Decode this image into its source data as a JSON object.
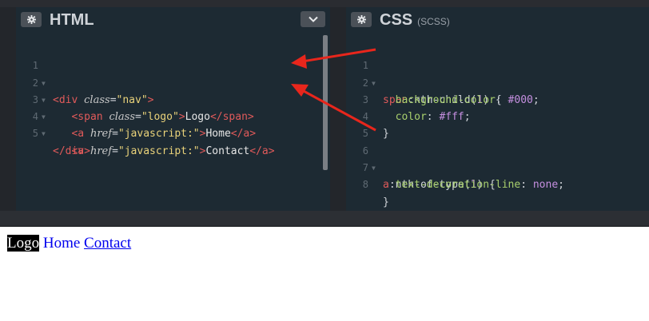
{
  "html_panel": {
    "title": "HTML",
    "lines": [
      {
        "n": "1",
        "fold": true
      },
      {
        "n": "2",
        "fold": true
      },
      {
        "n": "3",
        "fold": true
      },
      {
        "n": "4",
        "fold": true
      },
      {
        "n": "5",
        "fold": false
      }
    ],
    "code": {
      "l1": {
        "tag_open": "<div",
        "attr": "class",
        "eq": "=",
        "val": "\"nav\"",
        "close": ">"
      },
      "l2": {
        "tag_open": "<span",
        "attr": "class",
        "eq": "=",
        "val": "\"logo\"",
        "close": ">",
        "text": "Logo",
        "end": "</span>"
      },
      "l3": {
        "tag_open": "<a",
        "attr": "href",
        "eq": "=",
        "val": "\"javascript:\"",
        "close": ">",
        "text": "Home",
        "end": "</a>"
      },
      "l4": {
        "tag_open": "<a",
        "attr": "href",
        "eq": "=",
        "val": "\"javascript:\"",
        "close": ">",
        "text": "Contact",
        "end": "</a>"
      },
      "l5": {
        "end": "</div>"
      }
    }
  },
  "css_panel": {
    "title": "CSS",
    "subtitle": "(SCSS)",
    "lines": [
      "1",
      "2",
      "3",
      "4",
      "5",
      "6",
      "7",
      "8"
    ],
    "code": {
      "l1": {
        "sel": "span",
        "pseudo": ":nth-child(",
        "num": "1",
        "rest": ") {"
      },
      "l2": {
        "prop": "background-color",
        "colon": ": ",
        "val": "#000",
        "semi": ";"
      },
      "l3": {
        "prop": "color",
        "colon": ": ",
        "val": "#fff",
        "semi": ";"
      },
      "l4": {
        "brace": "}"
      },
      "l6": {
        "sel": "a",
        "pseudo": ":nth-of-type(",
        "num": "1",
        "rest": ") {"
      },
      "l7": {
        "prop": "text-decoration-line",
        "colon": ": ",
        "val": "none",
        "semi": ";"
      },
      "l8": {
        "brace": "}"
      }
    }
  },
  "preview": {
    "logo": "Logo",
    "home": "Home",
    "contact": "Contact"
  },
  "colors": {
    "arrow": "#e8261c",
    "tag": "#e05a5a",
    "string": "#e9d27a",
    "property": "#a8cf6d",
    "value": "#c58fe0"
  },
  "icons": [
    "gear-icon",
    "chevron-down-icon",
    "fold-arrow-icon"
  ]
}
